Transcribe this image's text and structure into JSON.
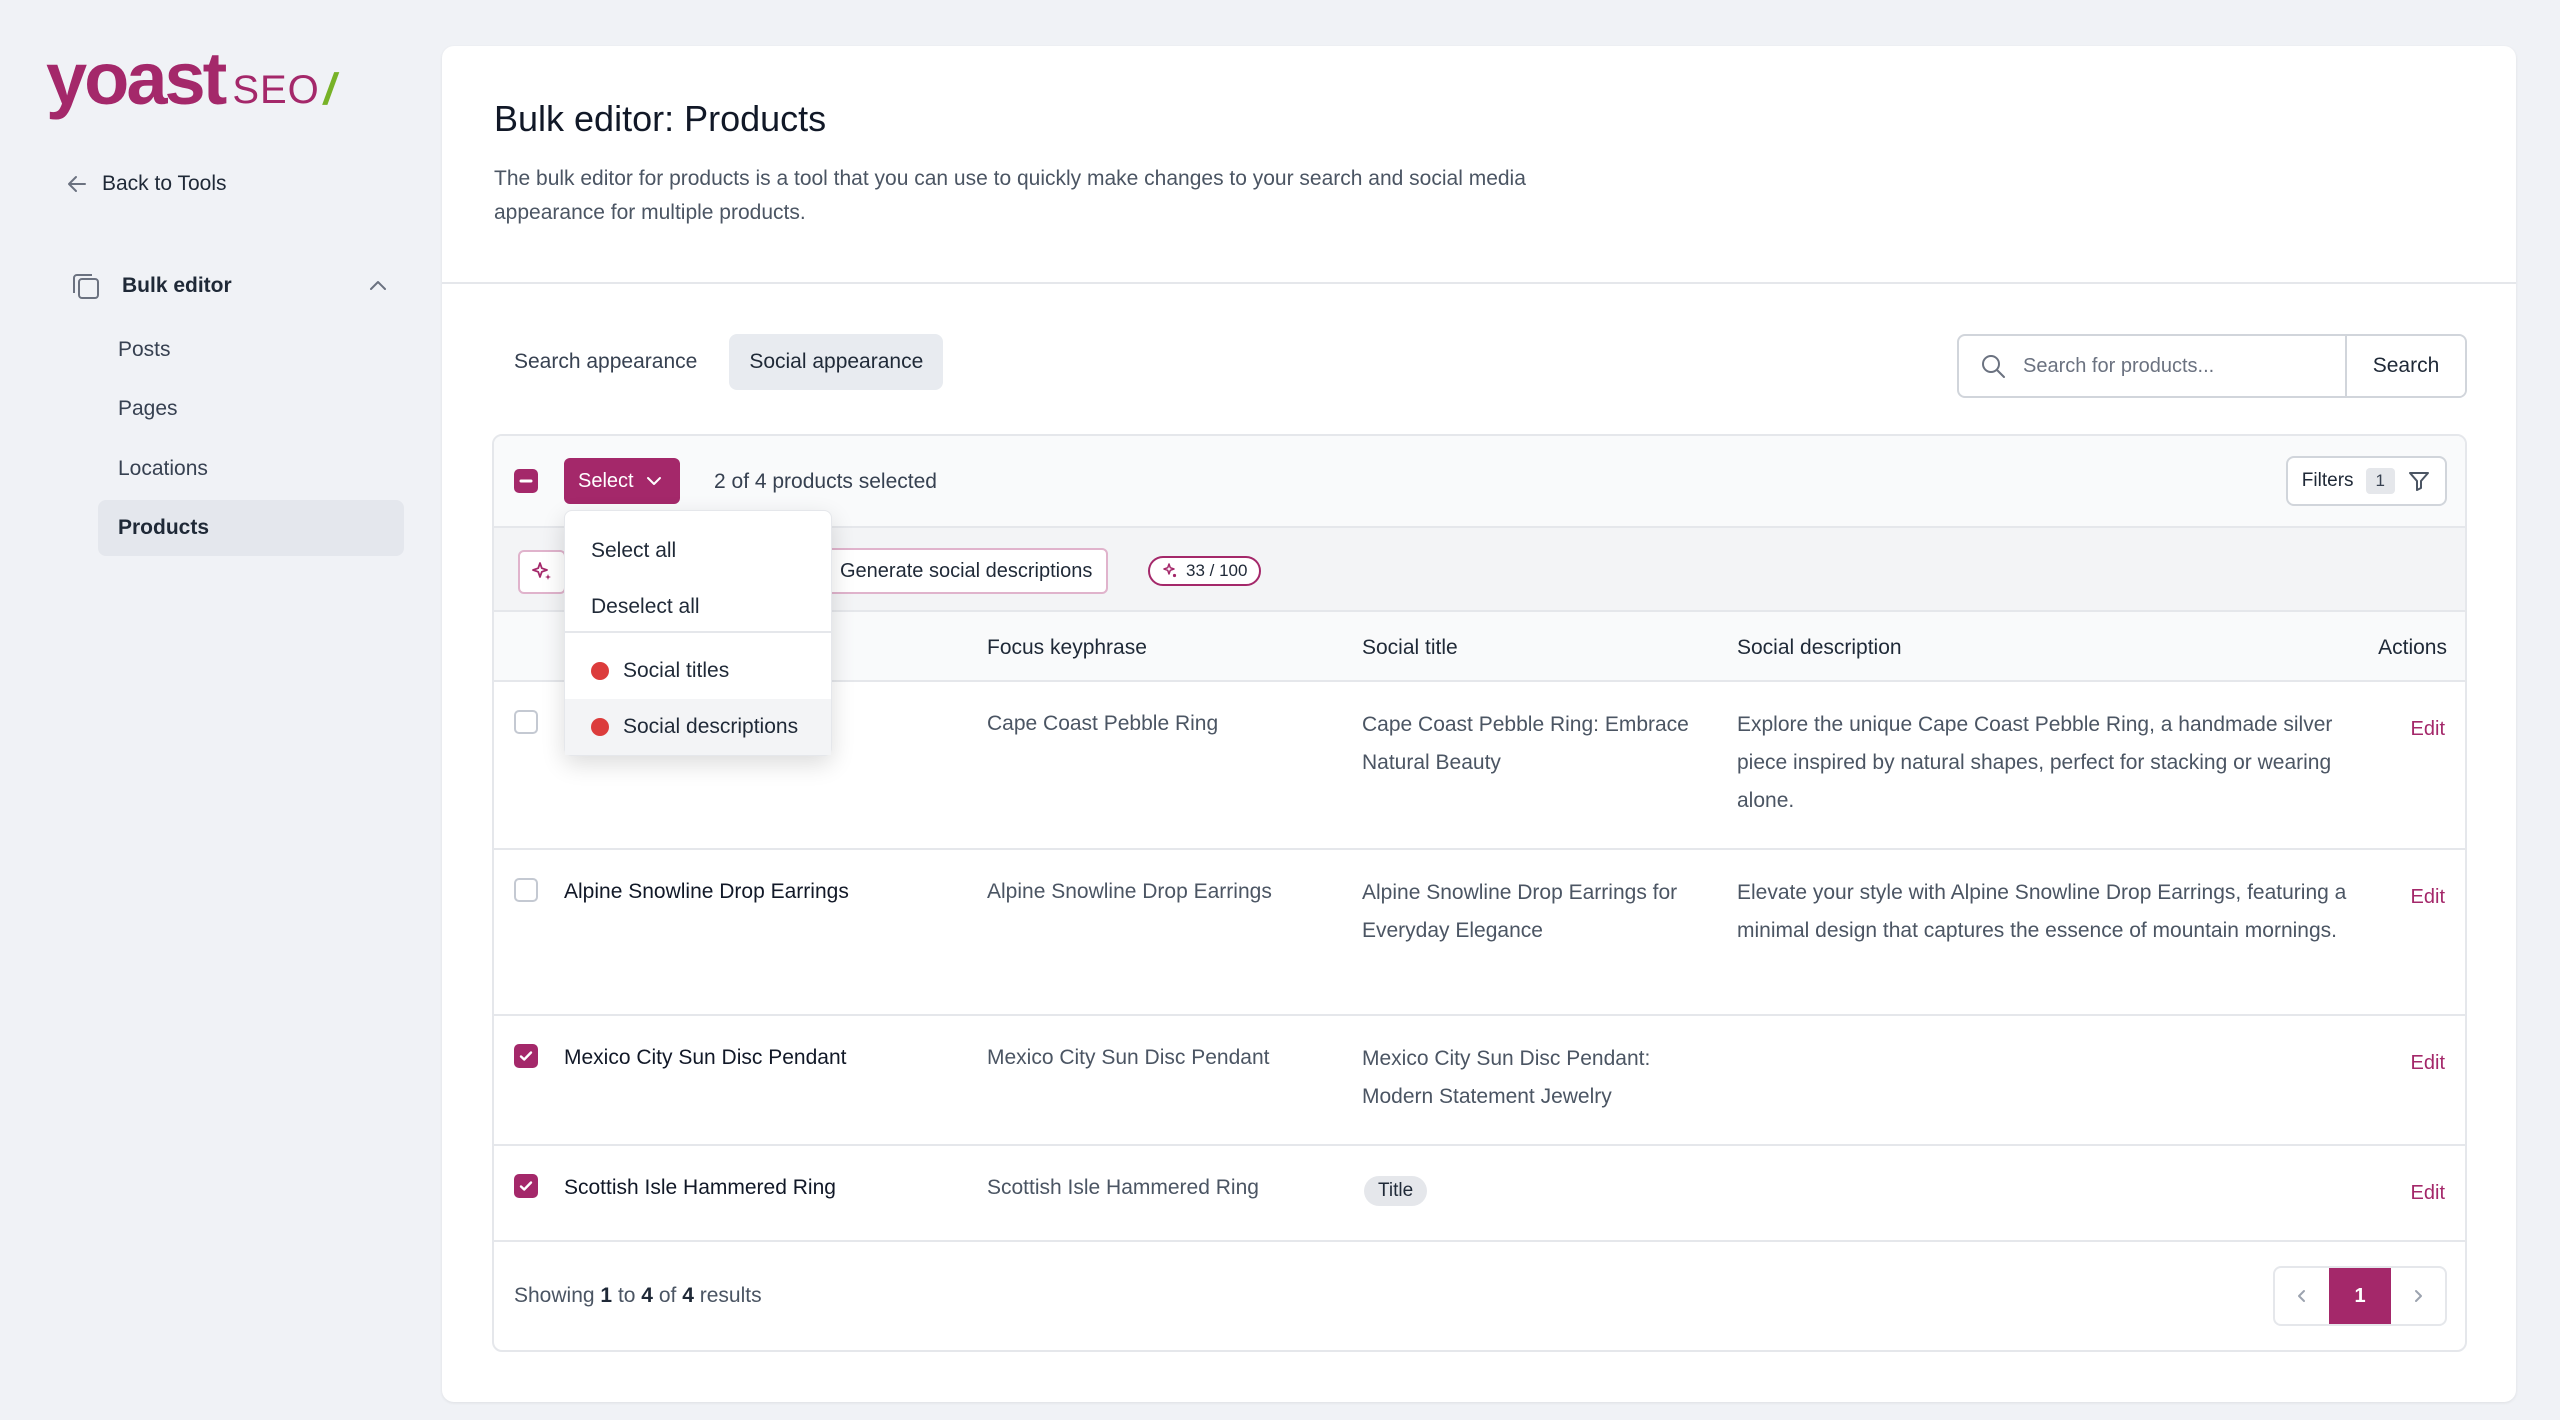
{
  "brand": {
    "logo_main": "yoast",
    "logo_seo": "SEO",
    "logo_slash": "/",
    "accent": "#a4286a",
    "slash_color": "#77b227"
  },
  "sidebar": {
    "back_label": "Back to Tools",
    "group_label": "Bulk editor",
    "items": [
      {
        "label": "Posts"
      },
      {
        "label": "Pages"
      },
      {
        "label": "Locations"
      },
      {
        "label": "Products",
        "active": true
      }
    ]
  },
  "main": {
    "title": "Bulk editor: Products",
    "description": "The bulk editor for products is a tool that you can use to quickly make changes to your search and social media appearance for multiple products.",
    "tabs": [
      {
        "label": "Search appearance"
      },
      {
        "label": "Social appearance",
        "active": true
      }
    ],
    "search": {
      "placeholder": "Search for products...",
      "button": "Search"
    }
  },
  "table": {
    "select_label": "Select",
    "selected_count": "2 of 4 products selected",
    "filters_label": "Filters",
    "filters_count": "1",
    "generate_label": "Generate social descriptions",
    "usage": "33 / 100",
    "columns": {
      "keyphrase": "Focus keyphrase",
      "social_title": "Social title",
      "social_description": "Social description",
      "actions": "Actions"
    },
    "rows": [
      {
        "name": "",
        "keyphrase": "Cape Coast Pebble Ring",
        "social_title": "Cape Coast Pebble Ring: Embrace Natural Beauty",
        "social_description": "Explore the unique Cape Coast Pebble Ring, a handmade silver piece inspired by natural shapes, perfect for stacking or wearing alone.",
        "action": "Edit",
        "checked": false
      },
      {
        "name": "Alpine Snowline Drop Earrings",
        "keyphrase": "Alpine Snowline Drop Earrings",
        "social_title": "Alpine Snowline Drop Earrings for Everyday Elegance",
        "social_description": "Elevate your style with Alpine Snowline Drop Earrings, featuring a minimal design that captures the essence of mountain mornings.",
        "action": "Edit",
        "checked": false
      },
      {
        "name": "Mexico City Sun Disc Pendant",
        "keyphrase": "Mexico City Sun Disc Pendant",
        "social_title": "Mexico City Sun Disc Pendant: Modern Statement Jewelry",
        "social_description": "",
        "action": "Edit",
        "checked": true
      },
      {
        "name": "Scottish Isle Hammered Ring",
        "keyphrase": "Scottish Isle Hammered Ring",
        "social_title_pill": "Title",
        "social_description": "",
        "action": "Edit",
        "checked": true
      }
    ],
    "footer": {
      "showing": "Showing",
      "from": "1",
      "to_word": "to",
      "to": "4",
      "of_word": "of",
      "total": "4",
      "results": "results"
    },
    "pagination": {
      "current": "1"
    }
  },
  "dropdown": {
    "items": [
      {
        "label": "Select all"
      },
      {
        "label": "Deselect all"
      },
      {
        "label": "Social titles",
        "dot_color": "#dc3c3c"
      },
      {
        "label": "Social descriptions",
        "dot_color": "#dc3c3c"
      }
    ]
  }
}
